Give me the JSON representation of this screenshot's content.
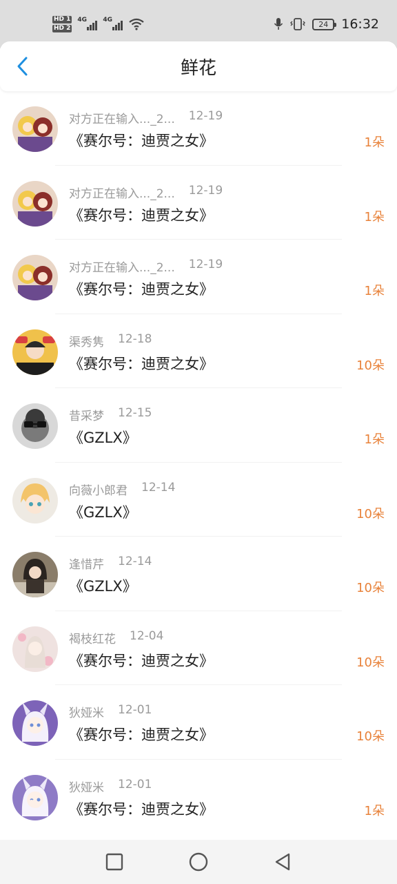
{
  "status_bar": {
    "time": "16:32",
    "battery": "24",
    "sim1": "HD 1",
    "sim2": "HD 2",
    "net1": "4G",
    "net2": "4G"
  },
  "header": {
    "title": "鲜花",
    "back_icon": "chevron-left-icon"
  },
  "colors": {
    "accent": "#1e8fe0",
    "count": "#e8823a",
    "meta": "#9a9a9a"
  },
  "items": [
    {
      "name": "对方正在输入..._2...",
      "date": "12-19",
      "book": "《赛尔号：迪贾之女》",
      "count": "1朵"
    },
    {
      "name": "对方正在输入..._2...",
      "date": "12-19",
      "book": "《赛尔号：迪贾之女》",
      "count": "1朵"
    },
    {
      "name": "对方正在输入..._2...",
      "date": "12-19",
      "book": "《赛尔号：迪贾之女》",
      "count": "1朵"
    },
    {
      "name": "渠秀隽",
      "date": "12-18",
      "book": "《赛尔号：迪贾之女》",
      "count": "10朵"
    },
    {
      "name": "昔采梦",
      "date": "12-15",
      "book": "《GZLX》",
      "count": "1朵"
    },
    {
      "name": "向薇小郎君",
      "date": "12-14",
      "book": "《GZLX》",
      "count": "10朵"
    },
    {
      "name": "逢惜芹",
      "date": "12-14",
      "book": "《GZLX》",
      "count": "10朵"
    },
    {
      "name": "褐枝红花",
      "date": "12-04",
      "book": "《赛尔号：迪贾之女》",
      "count": "10朵"
    },
    {
      "name": "狄娅米",
      "date": "12-01",
      "book": "《赛尔号：迪贾之女》",
      "count": "10朵"
    },
    {
      "name": "狄娅米",
      "date": "12-01",
      "book": "《赛尔号：迪贾之女》",
      "count": "1朵"
    }
  ],
  "nav": {
    "recent": "square-icon",
    "home": "circle-icon",
    "back": "triangle-back-icon"
  }
}
